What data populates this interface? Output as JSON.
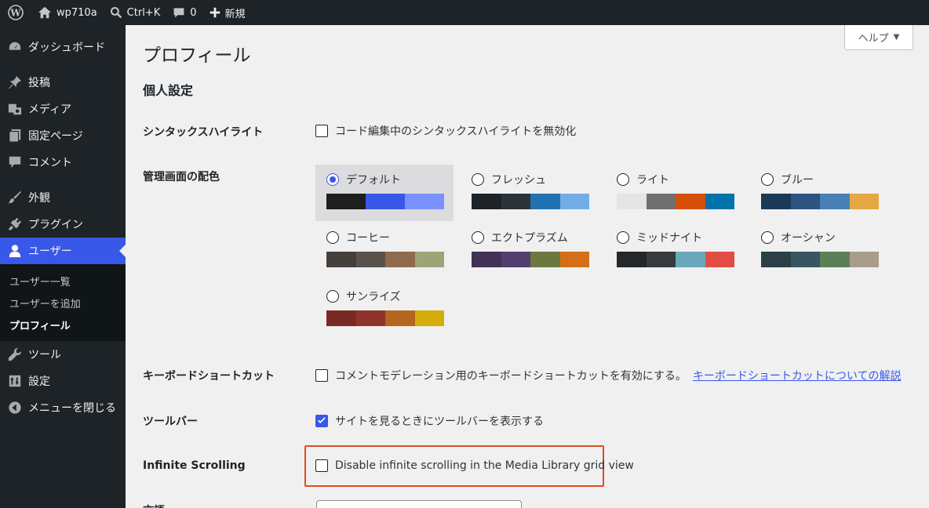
{
  "adminbar": {
    "site_name": "wp710a",
    "search_shortcut": "Ctrl+K",
    "comments_count": "0",
    "new_label": "新規"
  },
  "sidebar": {
    "items": [
      {
        "label": "ダッシュボード",
        "icon": "dashboard-icon"
      },
      {
        "label": "投稿",
        "icon": "pin-icon"
      },
      {
        "label": "メディア",
        "icon": "media-icon"
      },
      {
        "label": "固定ページ",
        "icon": "page-icon"
      },
      {
        "label": "コメント",
        "icon": "comment-icon"
      },
      {
        "label": "外観",
        "icon": "brush-icon"
      },
      {
        "label": "プラグイン",
        "icon": "plugin-icon"
      },
      {
        "label": "ユーザー",
        "icon": "user-icon"
      },
      {
        "label": "ツール",
        "icon": "wrench-icon"
      },
      {
        "label": "設定",
        "icon": "settings-icon"
      },
      {
        "label": "メニューを閉じる",
        "icon": "collapse-icon"
      }
    ],
    "users_submenu": [
      "ユーザー一覧",
      "ユーザーを追加",
      "プロフィール"
    ]
  },
  "main": {
    "help_label": "ヘルプ",
    "page_title": "プロフィール",
    "section_heading": "個人設定",
    "syntax": {
      "label": "シンタックスハイライト",
      "checkbox": "コード編集中のシンタックスハイライトを無効化",
      "checked": false
    },
    "color_scheme_label": "管理画面の配色",
    "schemes": [
      {
        "name": "デフォルト",
        "selected": true,
        "colors": [
          "#1e1e1e",
          "#3858e9",
          "#7b90ff",
          "#7b90ff"
        ]
      },
      {
        "name": "フレッシュ",
        "selected": false,
        "colors": [
          "#1d2327",
          "#2c3338",
          "#2271b1",
          "#72aee6"
        ]
      },
      {
        "name": "ライト",
        "selected": false,
        "colors": [
          "#e5e5e5",
          "#6f6f6f",
          "#d64e07",
          "#0073aa"
        ]
      },
      {
        "name": "ブルー",
        "selected": false,
        "colors": [
          "#1b3a57",
          "#2d5480",
          "#4a7fb5",
          "#e5a844"
        ]
      },
      {
        "name": "コーヒー",
        "selected": false,
        "colors": [
          "#46403c",
          "#59524c",
          "#8f6a4b",
          "#9ea476"
        ]
      },
      {
        "name": "エクトプラズム",
        "selected": false,
        "colors": [
          "#413256",
          "#523f6d",
          "#6b7940",
          "#d46f15"
        ]
      },
      {
        "name": "ミッドナイト",
        "selected": false,
        "colors": [
          "#25282b",
          "#363b3f",
          "#69a8bb",
          "#e14d43"
        ]
      },
      {
        "name": "オーシャン",
        "selected": false,
        "colors": [
          "#2c3f47",
          "#3a5562",
          "#5b8058",
          "#a89d8a"
        ]
      },
      {
        "name": "サンライズ",
        "selected": false,
        "colors": [
          "#7a2a24",
          "#8f332b",
          "#b5651d",
          "#d4ad0c"
        ]
      }
    ],
    "keyboard": {
      "label": "キーボードショートカット",
      "checkbox": "コメントモデレーション用のキーボードショートカットを有効にする。",
      "link": "キーボードショートカットについての解説",
      "checked": false
    },
    "toolbar": {
      "label": "ツールバー",
      "checkbox": "サイトを見るときにツールバーを表示する",
      "checked": true
    },
    "infinite": {
      "label": "Infinite Scrolling",
      "checkbox": "Disable infinite scrolling in the Media Library grid view",
      "checked": false
    },
    "language_label": "言語"
  }
}
